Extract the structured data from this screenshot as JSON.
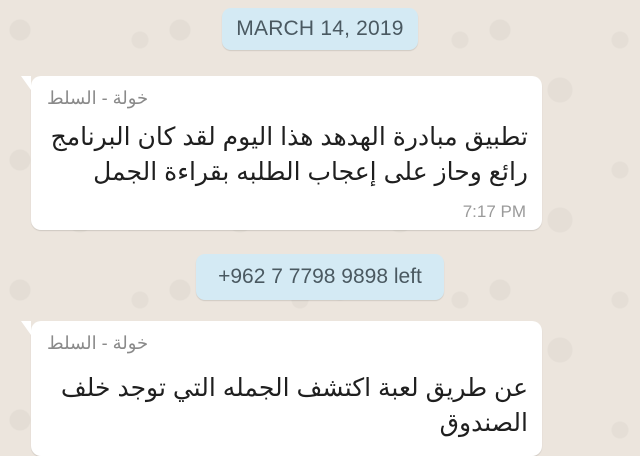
{
  "conversation": {
    "date_label": "MARCH 14, 2019",
    "messages": [
      {
        "sender": "خولة - السلط",
        "text": "تطبيق مبادرة الهدهد هذا اليوم لقد كان البرنامج\nرائع وحاز على إعجاب الطلبه بقراءة الجمل",
        "time": "7:17 PM"
      },
      {
        "sender": "خولة - السلط",
        "text": "عن طريق لعبة اكتشف الجمله التي توجد خلف\nالصندوق"
      }
    ],
    "system_notice": "+962 7 7798 9898 left"
  },
  "colors": {
    "chat_background": "#ece5dd",
    "message_bubble": "#ffffff",
    "system_pill": "#d4eaf4"
  }
}
